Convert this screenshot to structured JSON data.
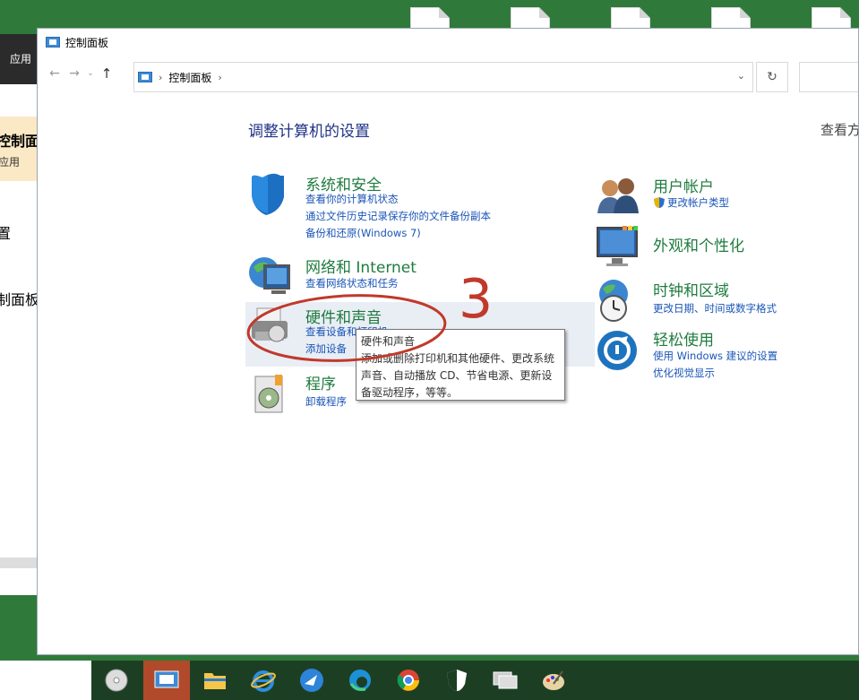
{
  "background_window": {
    "header": "应用",
    "item_control_panel": "控制面",
    "item_apps": "应用",
    "item_settings": "置",
    "item_control_panel_2": "制面板"
  },
  "window": {
    "title": "控制面板",
    "address_path": "控制面板",
    "heading": "调整计算机的设置",
    "view_by": "查看方"
  },
  "categories": {
    "system_security": {
      "title": "系统和安全",
      "links": [
        "查看你的计算机状态",
        "通过文件历史记录保存你的文件备份副本",
        "备份和还原(Windows 7)"
      ]
    },
    "network": {
      "title": "网络和 Internet",
      "links": [
        "查看网络状态和任务"
      ]
    },
    "hardware_sound": {
      "title": "硬件和声音",
      "links": [
        "查看设备和打印机",
        "添加设备"
      ]
    },
    "programs": {
      "title": "程序",
      "links": [
        "卸载程序"
      ]
    },
    "user_accounts": {
      "title": "用户帐户",
      "links": [
        "更改帐户类型"
      ]
    },
    "appearance": {
      "title": "外观和个性化",
      "links": []
    },
    "clock_region": {
      "title": "时钟和区域",
      "links": [
        "更改日期、时间或数字格式"
      ]
    },
    "ease_access": {
      "title": "轻松使用",
      "links": [
        "使用 Windows 建议的设置",
        "优化视觉显示"
      ]
    }
  },
  "tooltip": {
    "title": "硬件和声音",
    "body": "添加或删除打印机和其他硬件、更改系统声音、自动播放 CD、节省电源、更新设备驱动程序，等等。"
  },
  "annotation": {
    "number": "3",
    "color": "#c0392b"
  },
  "taskbar": {
    "icons": [
      "disc-icon",
      "control-panel-icon",
      "file-explorer-icon",
      "ie-icon",
      "bird-icon",
      "edge-icon",
      "chrome-icon",
      "shield-icon",
      "network-icon",
      "paint-icon"
    ]
  },
  "colors": {
    "accent_title": "#1f7c3f",
    "link": "#1a55b7",
    "heading": "#1e3287",
    "desktop": "#2f7a3a"
  }
}
